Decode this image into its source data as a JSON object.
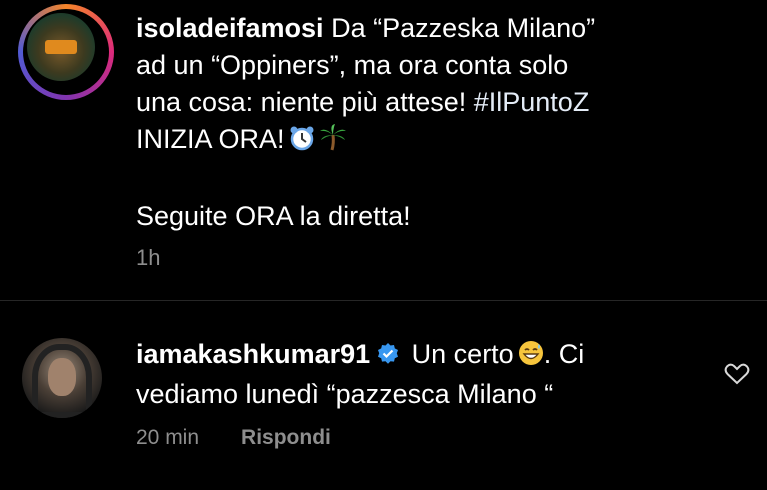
{
  "post": {
    "username": "isoladeifamosi",
    "caption_line1_rest": " Da “Pazzeska Milano”",
    "caption_line2": "ad un “Oppiners”, ma ora conta solo",
    "caption_line3_a": "una cosa: niente più attese! ",
    "hashtag": "#IlPuntoZ",
    "caption_line4": "INIZIA ORA!",
    "caption_line5": "Seguite ORA la diretta!",
    "time": "1h",
    "emoji_icons": [
      "alarm-clock-icon",
      "palm-tree-icon"
    ]
  },
  "comment": {
    "username": "iamakashkumar91",
    "text_a": " Un certo",
    "text_b": ". Ci",
    "text_line2": "vediamo lunedì “pazzesca Milano “",
    "time": "20 min",
    "reply_label": "Rispondi"
  },
  "colors": {
    "background": "#000000",
    "meta": "#8e8e8e",
    "verified": "#3897f0"
  }
}
